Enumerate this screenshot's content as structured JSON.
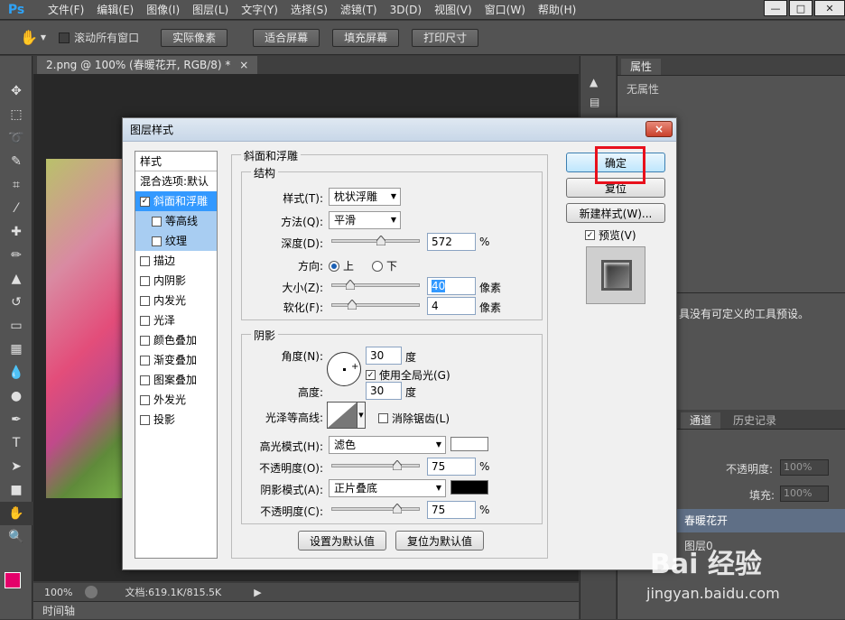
{
  "app": {
    "logo": "Ps",
    "menu": [
      "文件(F)",
      "编辑(E)",
      "图像(I)",
      "图层(L)",
      "文字(Y)",
      "选择(S)",
      "滤镜(T)",
      "3D(D)",
      "视图(V)",
      "窗口(W)",
      "帮助(H)"
    ]
  },
  "options_bar": {
    "scroll_all_label": "滚动所有窗口",
    "buttons": [
      "实际像素",
      "适合屏幕",
      "填充屏幕",
      "打印尺寸"
    ]
  },
  "document": {
    "tab_title": "2.png @ 100% (春暖花开, RGB/8) *",
    "zoom": "100%",
    "doc_info": "文档:619.1K/815.5K",
    "timeline_label": "时间轴"
  },
  "right_panel": {
    "properties_tab": "属性",
    "no_properties": "无属性",
    "preset_message": "具没有可定义的工具预设。",
    "tools_tab": "工具",
    "channels_tab": "通道",
    "history_tab": "历史记录",
    "opacity_label": "不透明度:",
    "opacity_value": "100%",
    "fill_label": "填充:",
    "fill_value": "100%",
    "layer1": "春暖花开",
    "layer2": "图层0"
  },
  "dialog": {
    "title": "图层样式",
    "close": "×",
    "styles_header": "样式",
    "blend_options": "混合选项:默认",
    "styles": [
      {
        "label": "斜面和浮雕",
        "checked": true,
        "state": "selected"
      },
      {
        "label": "等高线",
        "checked": false,
        "state": "sub"
      },
      {
        "label": "纹理",
        "checked": false,
        "state": "sub"
      },
      {
        "label": "描边",
        "checked": false,
        "state": "normal"
      },
      {
        "label": "内阴影",
        "checked": false,
        "state": "normal"
      },
      {
        "label": "内发光",
        "checked": false,
        "state": "normal"
      },
      {
        "label": "光泽",
        "checked": false,
        "state": "normal"
      },
      {
        "label": "颜色叠加",
        "checked": false,
        "state": "normal"
      },
      {
        "label": "渐变叠加",
        "checked": false,
        "state": "normal"
      },
      {
        "label": "图案叠加",
        "checked": false,
        "state": "normal"
      },
      {
        "label": "外发光",
        "checked": false,
        "state": "normal"
      },
      {
        "label": "投影",
        "checked": false,
        "state": "normal"
      }
    ],
    "bevel_group": "斜面和浮雕",
    "structure_group": "结构",
    "style_label": "样式(T):",
    "style_value": "枕状浮雕",
    "technique_label": "方法(Q):",
    "technique_value": "平滑",
    "depth_label": "深度(D):",
    "depth_value": "572",
    "depth_percent": 572,
    "direction_label": "方向:",
    "direction_up": "上",
    "direction_down": "下",
    "size_label": "大小(Z):",
    "size_value": "40",
    "size_unit": "像素",
    "soften_label": "软化(F):",
    "soften_value": "4",
    "soften_unit": "像素",
    "percent": "%",
    "shading_group": "阴影",
    "angle_label": "角度(N):",
    "angle_value": "30",
    "angle_unit": "度",
    "global_light_label": "使用全局光(G)",
    "altitude_label": "高度:",
    "altitude_value": "30",
    "altitude_unit": "度",
    "gloss_label": "光泽等高线:",
    "anti_alias_label": "消除锯齿(L)",
    "highlight_mode_label": "高光模式(H):",
    "highlight_mode_value": "滤色",
    "highlight_color": "#ffffff",
    "highlight_opacity_label": "不透明度(O):",
    "highlight_opacity_value": "75",
    "shadow_mode_label": "阴影模式(A):",
    "shadow_mode_value": "正片叠底",
    "shadow_color": "#000000",
    "shadow_opacity_label": "不透明度(C):",
    "shadow_opacity_value": "75",
    "set_default": "设置为默认值",
    "reset_default": "复位为默认值",
    "ok": "确定",
    "reset": "复位",
    "new_style": "新建样式(W)...",
    "preview_label": "预览(V)"
  },
  "watermark": {
    "brand": "Bai 经验",
    "url": "jingyan.baidu.com"
  }
}
